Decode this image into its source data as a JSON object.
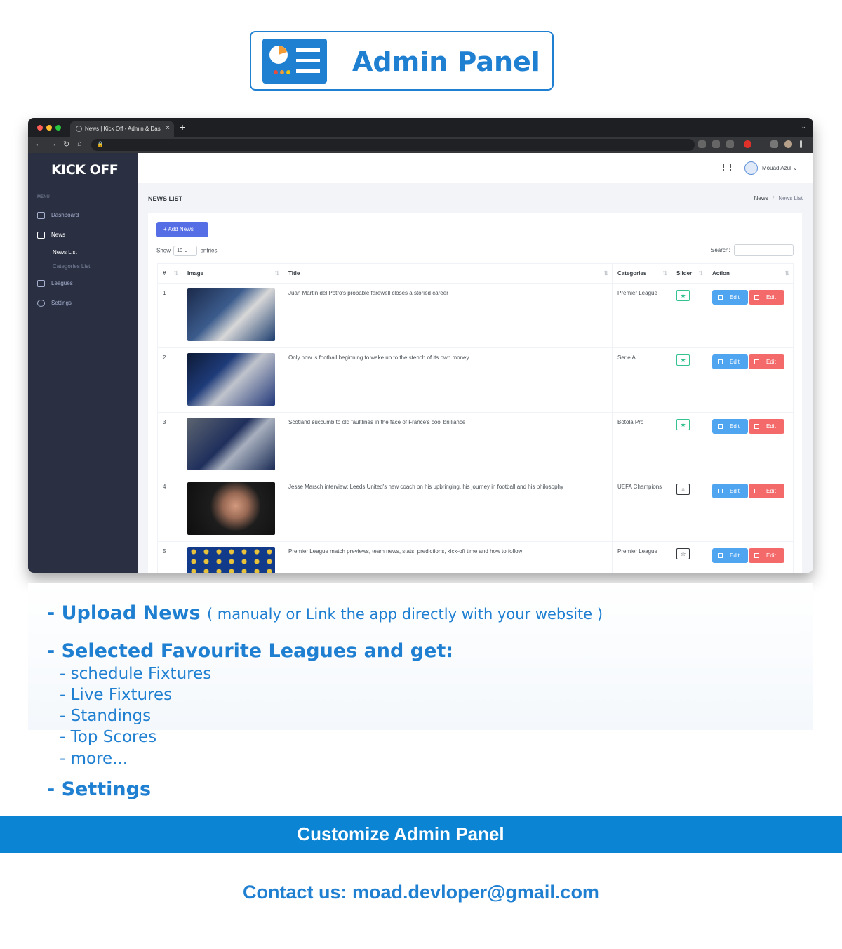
{
  "badge": {
    "title": "Admin Panel"
  },
  "browser": {
    "tab_title": "News | Kick Off - Admin & Das",
    "tab_close": "×",
    "new_tab": "+",
    "tabbar_chevron": "⌄",
    "nav_back": "←",
    "nav_forward": "→",
    "nav_reload": "↻",
    "nav_home": "⌂",
    "lock": "🔒",
    "traffic_colors": [
      "#ff5f57",
      "#febc2e",
      "#28c840"
    ]
  },
  "sidebar": {
    "brand": "KICK OFF",
    "menu_label": "MENU",
    "items": [
      {
        "label": "Dashboard",
        "icon": "home-icon"
      },
      {
        "label": "News",
        "icon": "newspaper-icon"
      },
      {
        "label": "Leagues",
        "icon": "folder-icon"
      },
      {
        "label": "Settings",
        "icon": "gear-icon"
      }
    ],
    "sub_items": [
      {
        "label": "News List"
      },
      {
        "label": "Categories List"
      }
    ]
  },
  "topbar": {
    "username": "Mouad Azul ⌄"
  },
  "page": {
    "title": "NEWS LIST",
    "breadcrumb": [
      "News",
      "News List"
    ],
    "breadcrumb_sep": "/"
  },
  "list": {
    "add_button": "+   Add News",
    "show_prefix": "Show",
    "show_value": "10  ⌄",
    "show_suffix": "entries",
    "search_label": "Search:",
    "columns": [
      "#",
      "Image",
      "Title",
      "Categories",
      "Slider",
      "Action"
    ],
    "sort_icon": "⇅",
    "star_icon": "★",
    "star_off_icon": "☆",
    "edit_label": "Edit",
    "delete_label": "Edit",
    "rows": [
      {
        "num": "1",
        "title": "Juan Martín del Potro's probable farewell closes a storied career",
        "category": "Premier League",
        "slider": true
      },
      {
        "num": "2",
        "title": "Only now is football beginning to wake up to the stench of its own money",
        "category": "Serie A",
        "slider": true
      },
      {
        "num": "3",
        "title": "Scotland succumb to old faultlines in the face of France's cool brilliance",
        "category": "Botola Pro",
        "slider": true
      },
      {
        "num": "4",
        "title": "Jesse Marsch interview: Leeds United's new coach on his upbringing, his journey in football and his philosophy",
        "category": "UEFA Champions",
        "slider": false
      },
      {
        "num": "5",
        "title": "Premier League match previews, team news, stats, predictions, kick-off time and how to follow",
        "category": "Premier League",
        "slider": false
      }
    ]
  },
  "features": {
    "upload_head": "- Upload News",
    "upload_note": "( manualy or Link the app directly with your website )",
    "leagues_head": "- Selected Favourite Leagues and get:",
    "leagues_items": [
      "- schedule Fixtures",
      "- Live Fixtures",
      "- Standings",
      "- Top Scores",
      "- more..."
    ],
    "settings_head": "- Settings"
  },
  "banner": "Customize Admin Panel",
  "contact": "Contact us: moad.devloper@gmail.com",
  "colors": {
    "accent": "#1f7fd1",
    "primary_btn": "#556ee6",
    "edit_btn": "#50a5f1",
    "delete_btn": "#f46a6a",
    "sidebar": "#2a3042"
  }
}
